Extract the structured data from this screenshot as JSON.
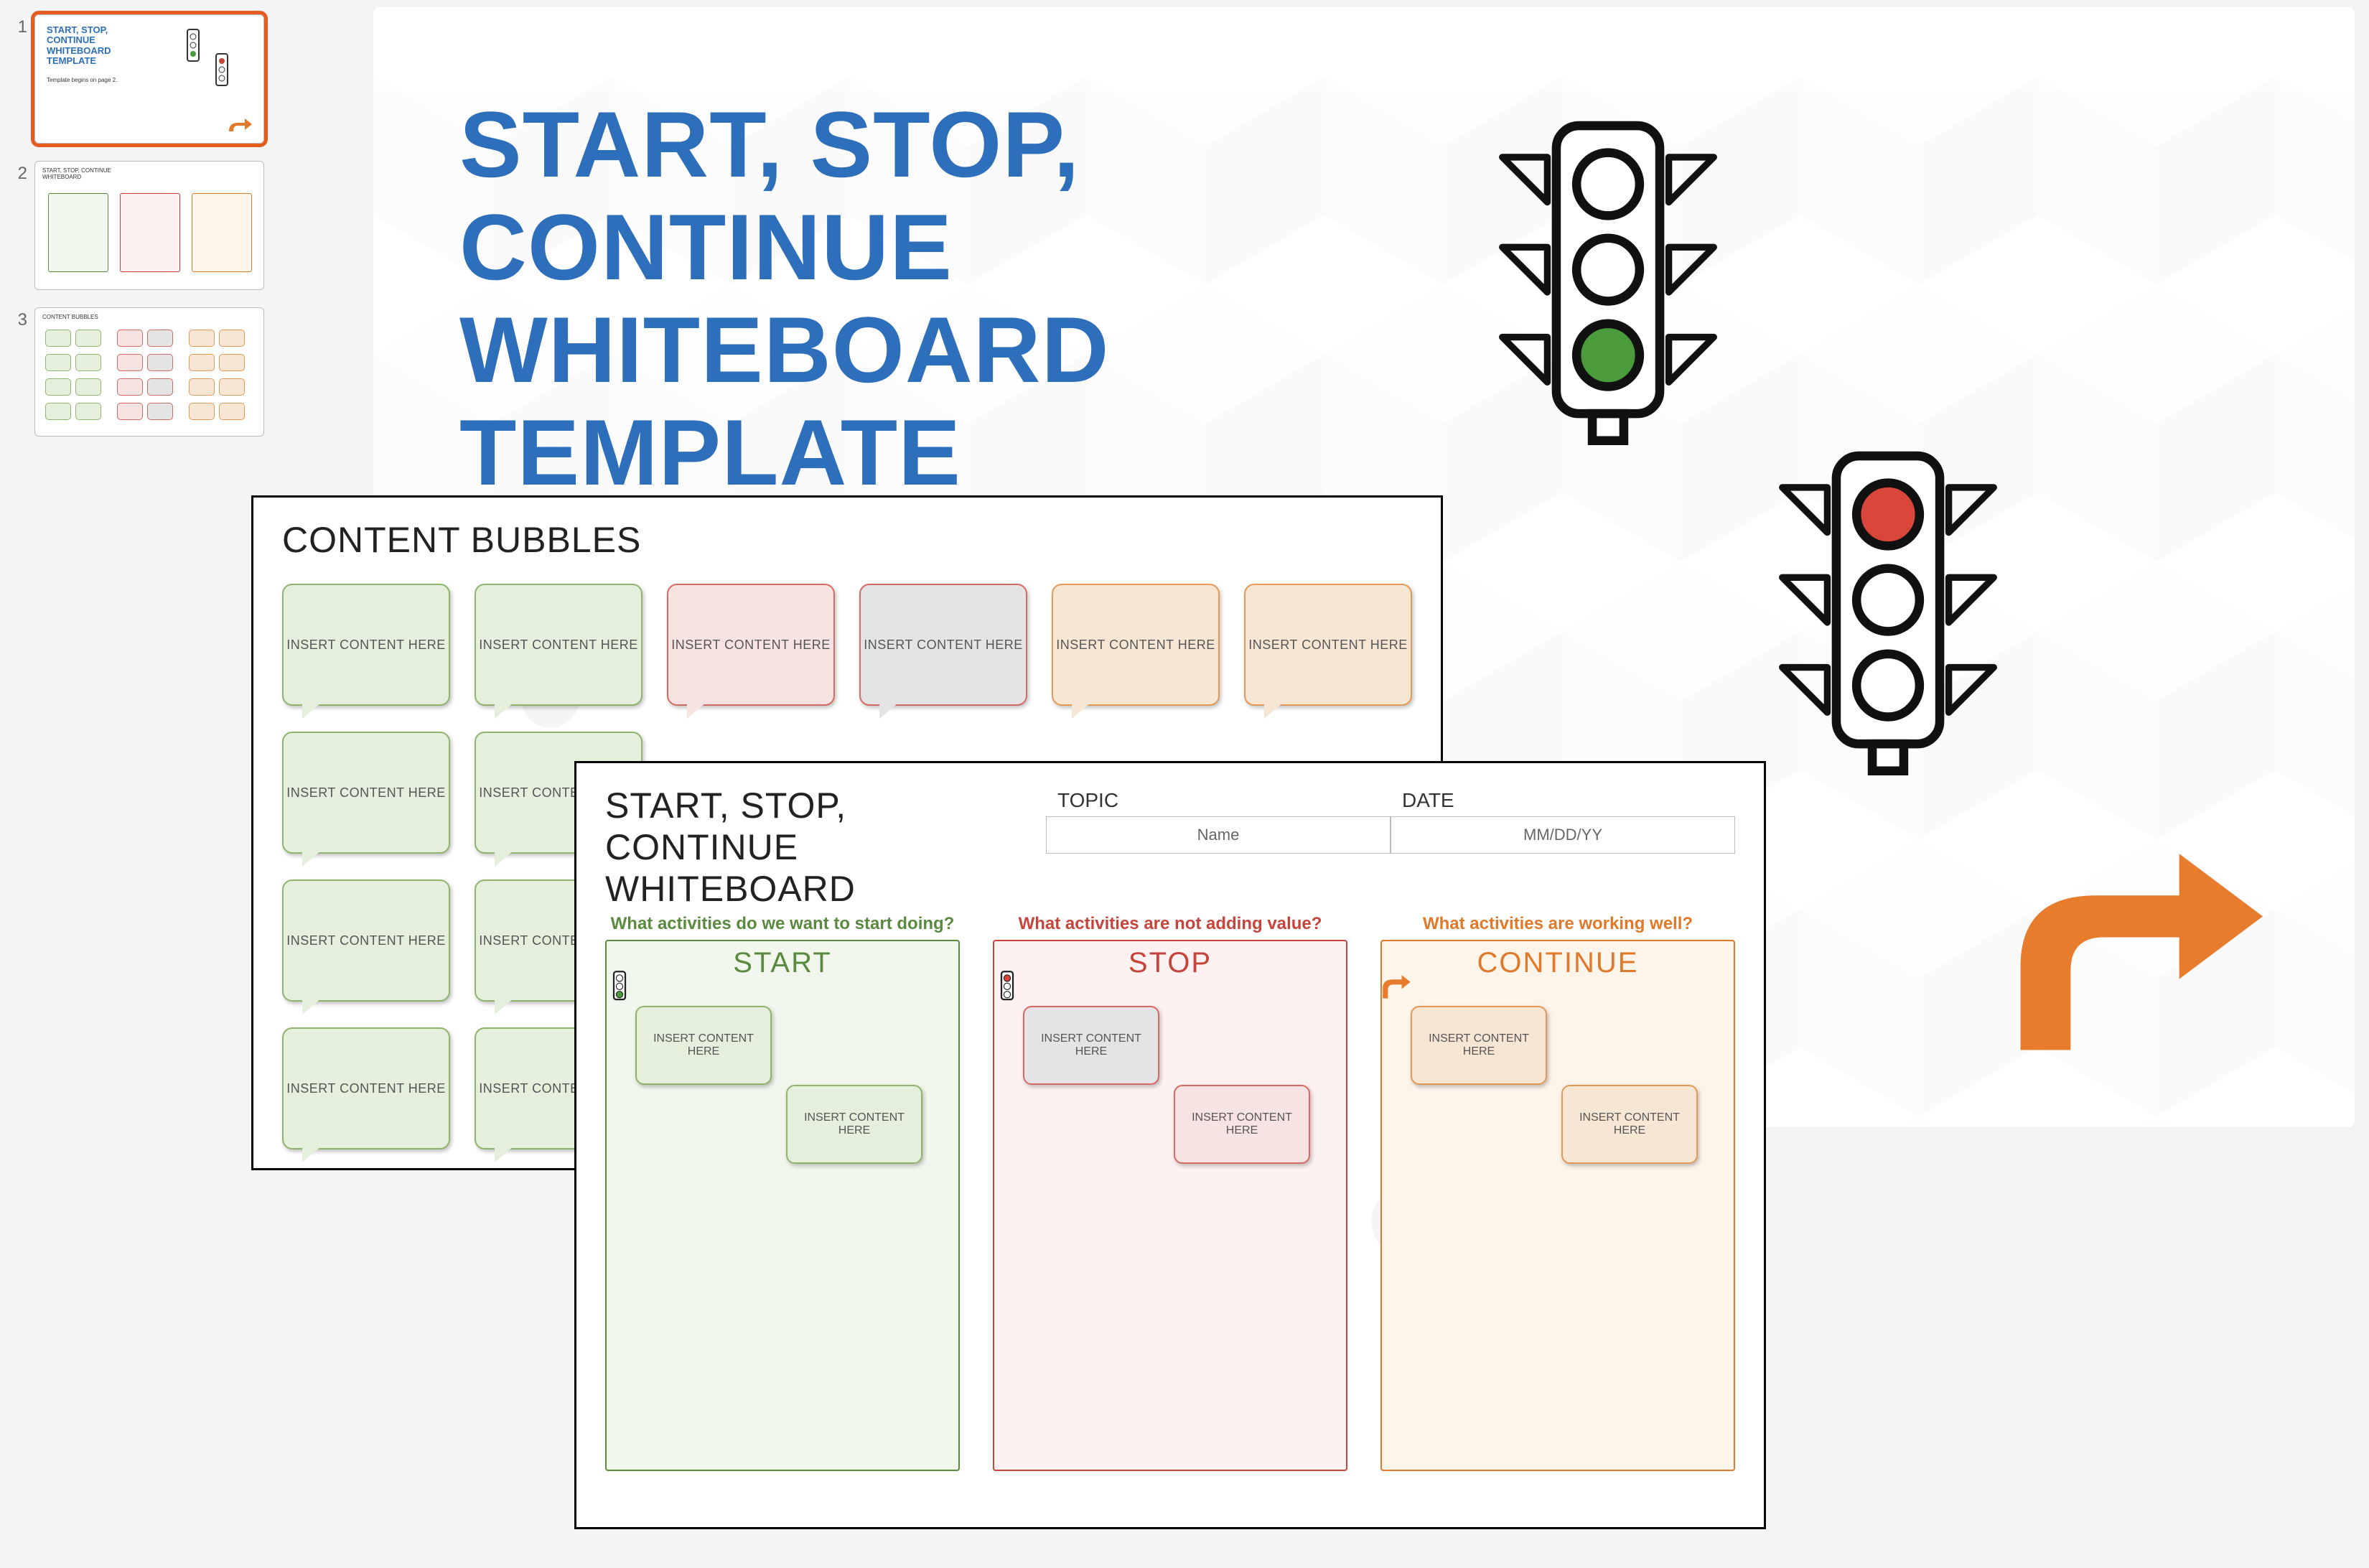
{
  "thumbs": [
    "1",
    "2",
    "3"
  ],
  "hero_title": "START, STOP, CONTINUE WHITEBOARD TEMPLATE",
  "thumb1_title": "START, STOP, CONTINUE WHITEBOARD TEMPLATE",
  "thumb1_sub": "Template begins on page 2.",
  "bubbles_panel_title": "CONTENT BUBBLES",
  "bubble_label": "INSERT CONTENT HERE",
  "whiteboard_panel_title": "START, STOP, CONTINUE WHITEBOARD",
  "wb_topic_label": "TOPIC",
  "wb_date_label": "DATE",
  "wb_topic_value": "Name",
  "wb_date_value": "MM/DD/YY",
  "cols": {
    "start": {
      "q": "What activities do we want to start doing?",
      "title": "START"
    },
    "stop": {
      "q": "What activities are not adding value?",
      "title": "STOP"
    },
    "continue": {
      "q": "What activities are working well?",
      "title": "CONTINUE"
    }
  }
}
